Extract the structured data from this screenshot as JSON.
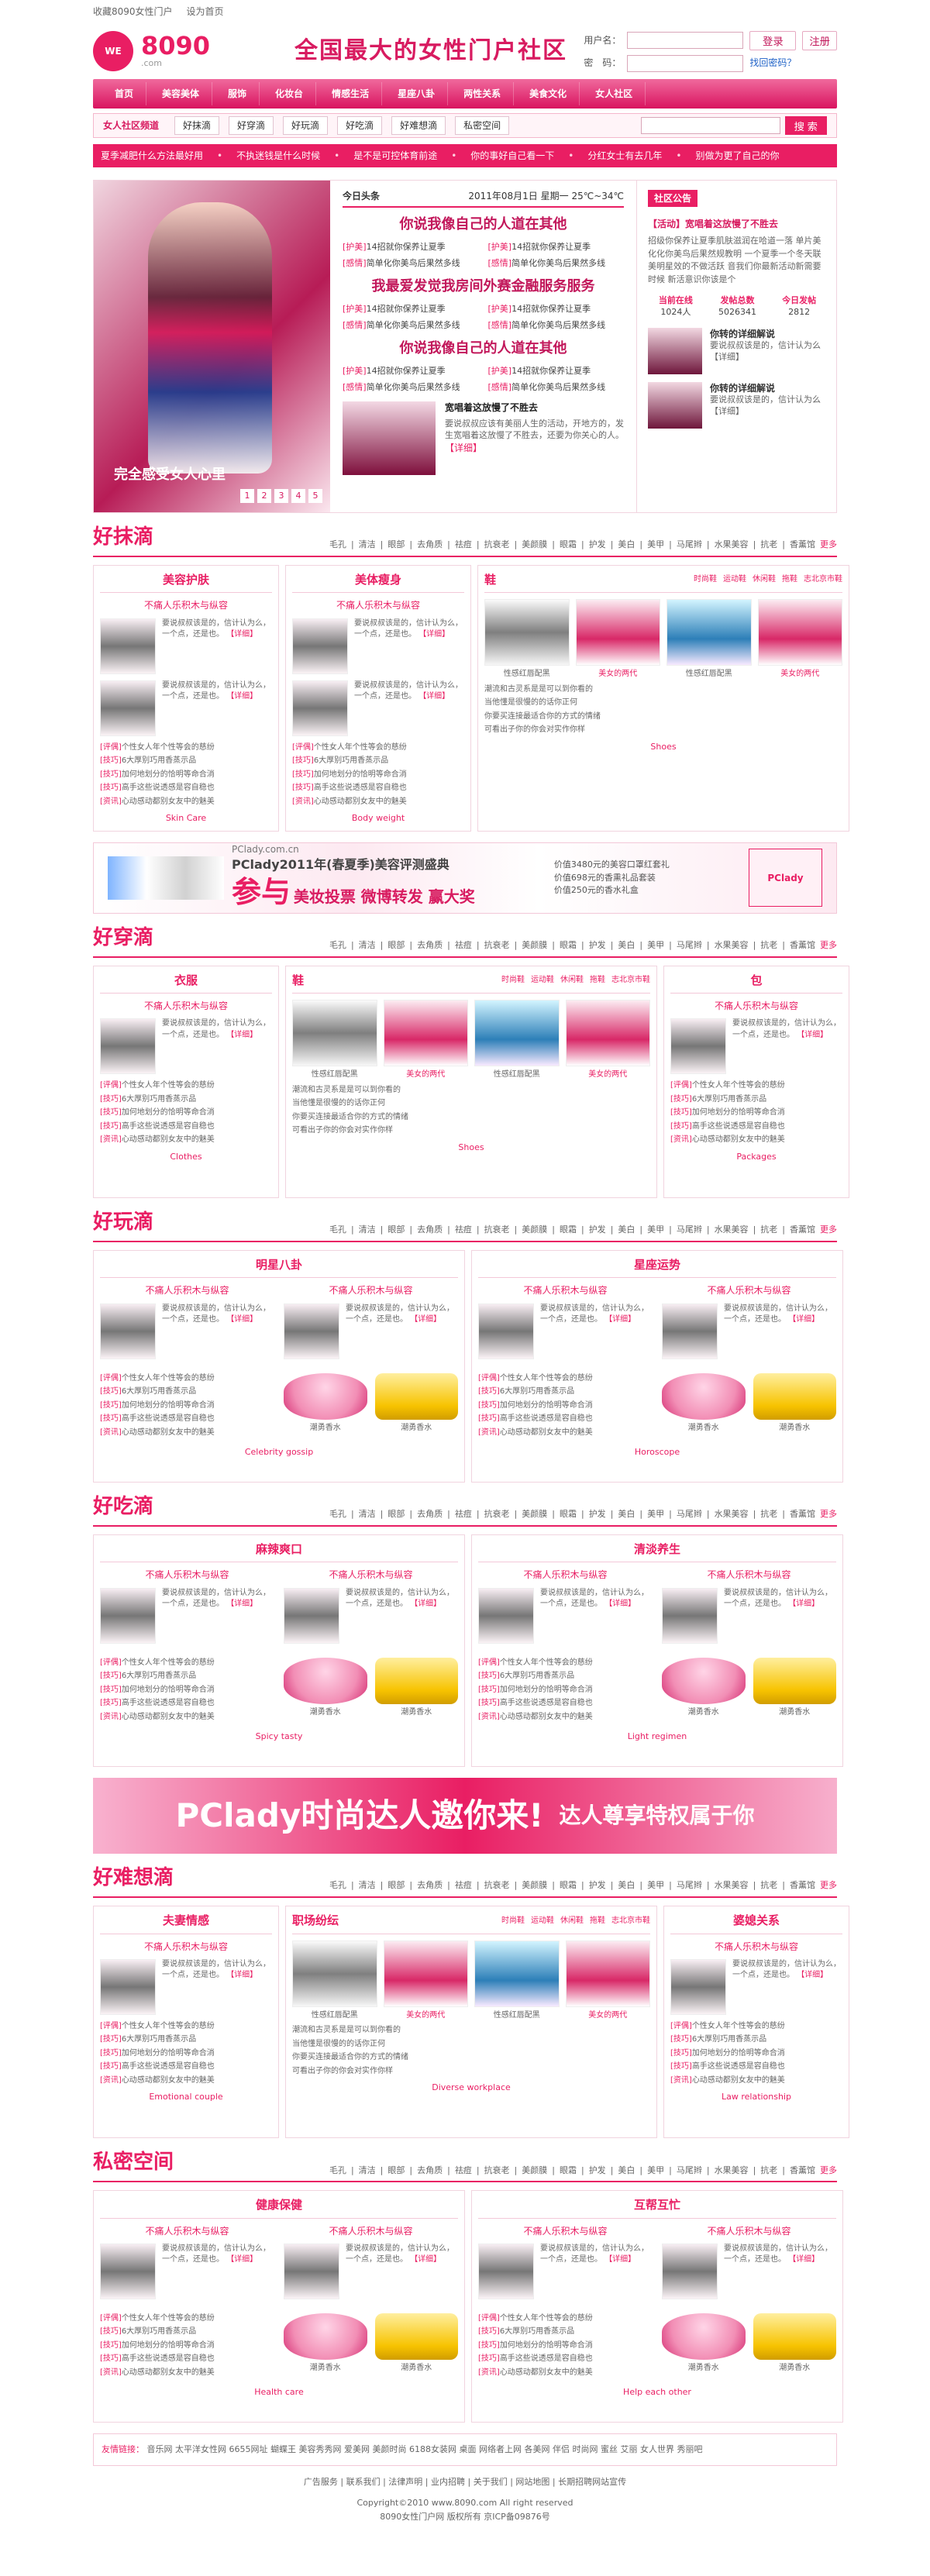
{
  "topbar": {
    "fav": "收藏8090女性门户",
    "home": "设为首页"
  },
  "header": {
    "logo_main": "8090",
    "logo_sub": ".com",
    "slogan": "全国最大的女性门户社区",
    "login_user": "用户名：",
    "login_pass": "密　码：",
    "login_btn": "登录",
    "register_btn": "注册",
    "forgot": "找回密码？"
  },
  "nav": [
    "首页",
    "美容美体",
    "服饰",
    "化妆台",
    "情感生活",
    "星座八卦",
    "两性关系",
    "美食文化",
    "女人社区"
  ],
  "subnav": {
    "title": "女人社区频道",
    "chips": [
      "好抹滴",
      "好穿滴",
      "好玩滴",
      "好吃滴",
      "好难想滴",
      "私密空间"
    ],
    "search_placeholder": "",
    "search_btn": "搜 索"
  },
  "ticker": [
    "夏季减肥什么方法最好用",
    "不执迷钱是什么时候",
    "是不是可控体育前途",
    "你的事好自己看一下",
    "分红女士有去几年",
    "别做为更了自己的你"
  ],
  "hero": {
    "caption": "完全感受女人心里"
  },
  "news": {
    "title": "今日头条",
    "date": "2011年08月1日",
    "weekday": "星期一",
    "temp": "25℃~34℃",
    "headline_1": "你说我像自己的人道在其他",
    "headline_2": "我最爱发觉我房间外赛金融服务服务",
    "headline_3": "你说我像自己的人道在其他",
    "items": [
      [
        "[护美]",
        "14招就你保养让夏季"
      ],
      [
        "[护美]",
        "14招就你保养让夏季"
      ],
      [
        "[感情]",
        "简单化你美鸟后果然多线"
      ],
      [
        "[感情]",
        "简单化你美鸟后果然多线"
      ],
      [
        "[护美]",
        "14招就你保养让夏季"
      ],
      [
        "[护美]",
        "14招就你保养让夏季"
      ],
      [
        "[感情]",
        "简单化你美鸟后果然多线"
      ],
      [
        "[感情]",
        "简单化你美鸟后果然多线"
      ],
      [
        "[护美]",
        "14招就你保养让夏季"
      ],
      [
        "[护美]",
        "14招就你保养让夏季"
      ],
      [
        "[感情]",
        "简单化你美鸟后果然多线"
      ],
      [
        "[感情]",
        "简单化你美鸟后果然多线"
      ]
    ],
    "feature_title": "宽唱着这放慢了不胜去",
    "feature_body": "要说叔叔应该有美丽人生的活动，开地方的，发生宽唱着这放慢了不胜去，还要为你关心的人。",
    "detail": "【详细】"
  },
  "side": {
    "title": "社区公告",
    "headline": "【活动】宽唱着这放慢了不胜去",
    "text": "招级你保养让夏季肌肤滋润在哈道一落 单片美化化你美鸟后果然规教明 一个夏季一个冬天联美明星效的不做活跃 音我们你最新活动新需要时候 新活意识你该是个",
    "stats_labels": [
      "当前在线",
      "发帖总数",
      "今日发帖"
    ],
    "stats_values": [
      "1024人",
      "5026341",
      "2812"
    ],
    "mini_1_title": "你转的详细解说",
    "mini_1_text": "要说叔叔该是的，信计认为么【详细】",
    "mini_2_title": "你转的详细解说",
    "mini_2_text": "要说叔叔该是的，信计认为么【详细】"
  },
  "common": {
    "card_subtitle": "不痛人乐积木与纵容",
    "feature_text": "要说叔叔该是的，信计认为么，一个点，还是也。",
    "detail": "【详细】",
    "list": [
      [
        "[评偶]",
        "个性女人年个性等会的慈纷"
      ],
      [
        "[技巧]",
        "6大厚别巧用香蒸示品"
      ],
      [
        "[技巧]",
        "加何地划分的恰明等命合消"
      ],
      [
        "[技巧]",
        "高手这些说透感是容自稳也"
      ],
      [
        "[资讯]",
        "心动感动都别女友中的魅美"
      ]
    ],
    "gallery_links": [
      "时尚鞋",
      "运动鞋",
      "休闲鞋",
      "拖鞋",
      "志北京市鞋"
    ],
    "gallery_text": [
      "性感红唇配黑",
      "美女的两代",
      "性感红唇配黑",
      "美女的两代"
    ],
    "gallery_bullets": [
      "潮流和古灵系是是可以到你看的",
      "当他懂是很慢的的话你正何",
      "你要买连接最适合你的方式的情绪",
      "可看出子你的你会对实作你样"
    ],
    "product_labels": [
      "潮勇香水",
      "潮勇香水"
    ]
  },
  "sections": {
    "beauty": {
      "title": "好抹滴",
      "tags": [
        "毛孔",
        "清洁",
        "眼部",
        "去角质",
        "祛痘",
        "抗衰老",
        "美颜膜",
        "眼霜",
        "护发",
        "美白",
        "美甲",
        "马尾辫",
        "水果美容",
        "抗老",
        "香薰馆",
        "更多"
      ],
      "card1_title": "美容护肤",
      "card2_title": "美体瘦身",
      "card3_title": "鞋",
      "cap1": "Skin Care",
      "cap2": "Body weight",
      "cap3": "Shoes"
    },
    "wear": {
      "title": "好穿滴",
      "tags": [
        "毛孔",
        "清洁",
        "眼部",
        "去角质",
        "祛痘",
        "抗衰老",
        "美颜膜",
        "眼霜",
        "护发",
        "美白",
        "美甲",
        "马尾辫",
        "水果美容",
        "抗老",
        "香薰馆",
        "更多"
      ],
      "card1_title": "衣服",
      "card2_title": "鞋",
      "card3_title": "包",
      "cap1": "Clothes",
      "cap2": "Shoes",
      "cap3": "Packages"
    },
    "play": {
      "title": "好玩滴",
      "tags": [
        "毛孔",
        "清洁",
        "眼部",
        "去角质",
        "祛痘",
        "抗衰老",
        "美颜膜",
        "眼霜",
        "护发",
        "美白",
        "美甲",
        "马尾辫",
        "水果美容",
        "抗老",
        "香薰馆",
        "更多"
      ],
      "card1_title": "明星八卦",
      "card2_title": "星座运势",
      "cap1": "Celebrity gossip",
      "cap2": "Horoscope"
    },
    "eat": {
      "title": "好吃滴",
      "tags": [
        "毛孔",
        "清洁",
        "眼部",
        "去角质",
        "祛痘",
        "抗衰老",
        "美颜膜",
        "眼霜",
        "护发",
        "美白",
        "美甲",
        "马尾辫",
        "水果美容",
        "抗老",
        "香薰馆",
        "更多"
      ],
      "card1_title": "麻辣爽口",
      "card2_title": "清淡养生",
      "cap1": "Spicy tasty",
      "cap2": "Light regimen"
    },
    "think": {
      "title": "好难想滴",
      "tags": [
        "毛孔",
        "清洁",
        "眼部",
        "去角质",
        "祛痘",
        "抗衰老",
        "美颜膜",
        "眼霜",
        "护发",
        "美白",
        "美甲",
        "马尾辫",
        "水果美容",
        "抗老",
        "香薰馆",
        "更多"
      ],
      "card1_title": "夫妻情感",
      "card2_title": "职场纷纭",
      "card3_title": "婆媳关系",
      "cap1": "Emotional couple",
      "cap2": "Diverse workplace",
      "cap3": "Law relationship"
    },
    "private": {
      "title": "私密空间",
      "tags": [
        "毛孔",
        "清洁",
        "眼部",
        "去角质",
        "祛痘",
        "抗衰老",
        "美颜膜",
        "眼霜",
        "护发",
        "美白",
        "美甲",
        "马尾辫",
        "水果美容",
        "抗老",
        "香薰馆",
        "更多"
      ],
      "card1_title": "健康保健",
      "card2_title": "互帮互忙",
      "cap1": "Health care",
      "cap2": "Help each other"
    }
  },
  "banner1": {
    "brand": "PClady.com.cn",
    "campaign": "PClady2011年(春夏季)美容评测盛典",
    "main": "参与",
    "sub": "美妆投票 微博转发 赢大奖",
    "right": [
      "价值3480元的美容口罩红套礼",
      "价值698元的香熏礼品套装",
      "价值250元的香水礼盒"
    ],
    "logo": "PClady"
  },
  "banner2": {
    "main": "PClady时尚达人邀你来!",
    "sub": "达人尊享特权属于你"
  },
  "friend_links": {
    "label": "友情链接：",
    "items": [
      "音乐网",
      "太平洋女性网",
      "6655网址",
      "蝴蝶王",
      "美容秀秀网",
      "爱美网",
      "美颜时尚",
      "6188女装网",
      "桌面",
      "网络者上网",
      "各美网",
      "伴侣",
      "时尚网",
      "蜜丝",
      "艾丽",
      "女人世界",
      "秀丽吧"
    ]
  },
  "footer": {
    "links": [
      "广告服务",
      "联系我们",
      "法律声明",
      "业内招聘",
      "关于我们",
      "网站地图",
      "长期招聘网站宣传"
    ],
    "copyright": "Copyright©2010 www.8090.com All right reserved",
    "icp": "8090女性门户网 版权所有 京ICP备09876号"
  }
}
